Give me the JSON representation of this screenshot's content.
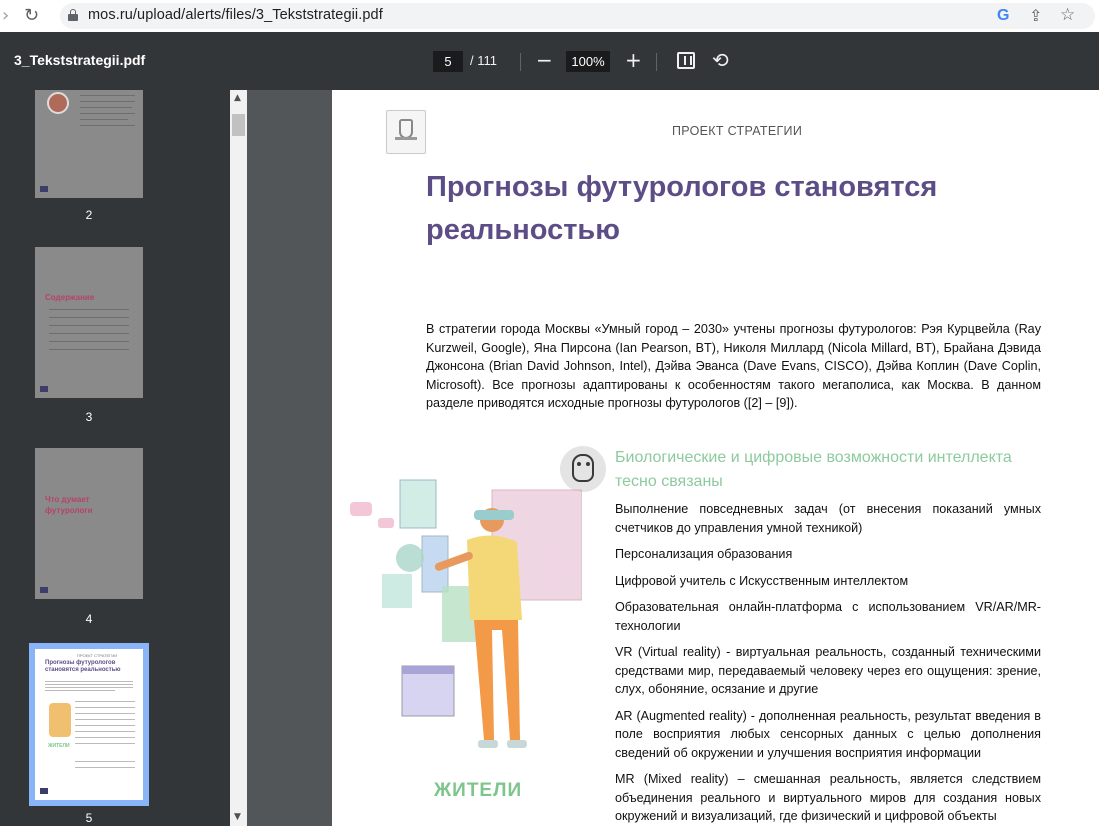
{
  "browser": {
    "back_icon": "back-arrow-icon",
    "reload_icon": "reload-icon",
    "url": "mos.ru/upload/alerts/files/3_Tekststrategii.pdf",
    "google_label": "G"
  },
  "pdf_toolbar": {
    "title": "3_Tekststrategii.pdf",
    "current_page": "5",
    "total_pages": "/ 111",
    "zoom": "100%",
    "zoom_out_label": "−",
    "zoom_in_label": "+"
  },
  "thumbnails": [
    {
      "num": "2"
    },
    {
      "num": "3",
      "text": "Содержание"
    },
    {
      "num": "4",
      "text": "Что думает футурологи"
    },
    {
      "num": "5",
      "title": "Прогнозы футурологов становятся реальностью",
      "header": "ПРОЕКТ СТРАТЕГИИ",
      "label": "ЖИТЕЛИ",
      "active": true
    }
  ],
  "page": {
    "header": "ПРОЕКТ СТРАТЕГИИ",
    "title": "Прогнозы футурологов становятся реальностью",
    "intro": "В стратегии города Москвы «Умный город – 2030» учтены прогнозы футурологов: Рэя Курцвейла (Ray Kurzweil, Google), Яна Пирсона (Ian Pearson, BT), Николя Миллард (Nicola Millard, BT), Брайана Дэвида Джонсона (Brian David Johnson, Intel), Дэйва Эванса (Dave Evans, CISCO), Дэйва Коплин (Dave Coplin, Microsoft). Все прогнозы адаптированы к особенностям такого мегаполиса, как Москва. В данном разделе приводятся исходные прогнозы футурологов ([2] – [9]).",
    "section_title": "Биологические и цифровые возможности интеллекта тесно связаны",
    "items": [
      "Выполнение повседневных задач (от внесения показаний умных счетчиков до управления умной техникой)",
      "Персонализация образования",
      "Цифровой учитель с Искусственным интеллектом",
      "Образовательная онлайн-платформа с использованием VR/AR/MR-технологии",
      "VR (Virtual reality) - виртуальная реальность, созданный техническими средствами мир, передаваемый человеку через его ощущения: зрение, слух, обоняние, осязание и другие",
      "AR (Augmented reality) - дополненная реальность, результат введения в поле восприятия любых сенсорных данных с целью дополнения сведений об окружении и улучшения восприятия информации",
      "MR (Mixed reality) – смешанная реальность, является следствием объединения реального и виртуального миров для создания новых окружений и визуализаций, где физический и цифровой объекты"
    ],
    "illustration_label": "ЖИТЕЛИ"
  },
  "colors": {
    "title_purple": "#5d4d86",
    "accent_green": "#8dca9d",
    "toolbar_bg": "#323639",
    "viewer_bg": "#525659"
  }
}
